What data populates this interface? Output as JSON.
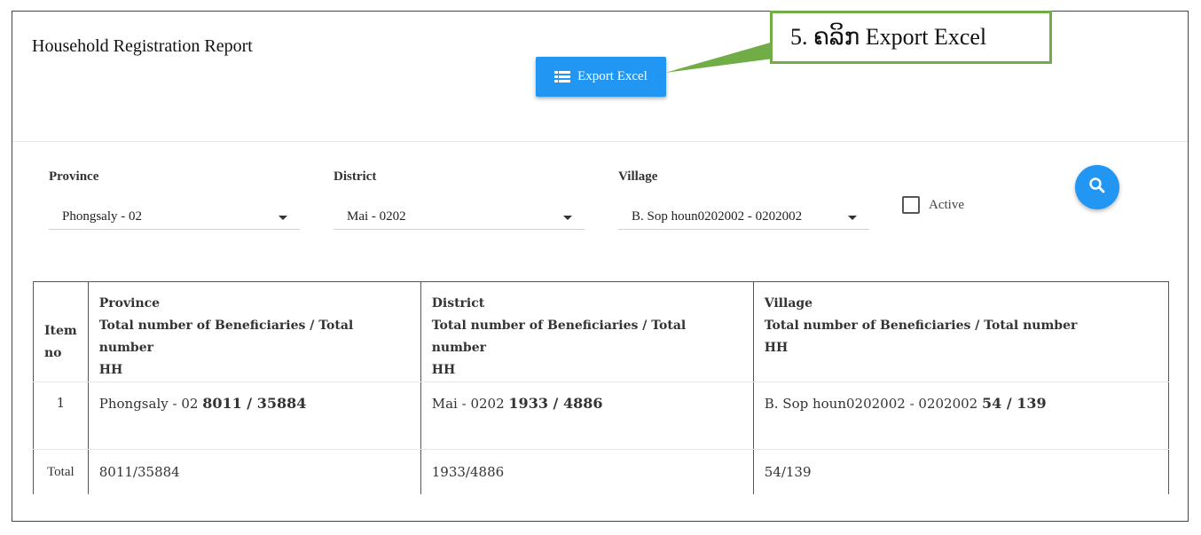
{
  "header": {
    "title": "Household Registration Report",
    "export_label": "Export Excel"
  },
  "filters": {
    "province": {
      "label": "Province",
      "value": "Phongsaly - 02"
    },
    "district": {
      "label": "District",
      "value": "Mai - 0202"
    },
    "village": {
      "label": "Village",
      "value": "B. Sop houn0202002 - 0202002"
    },
    "active_label": "Active"
  },
  "table": {
    "headers": {
      "item": [
        "Item",
        "no"
      ],
      "province": [
        "Province",
        "Total number of Beneficiaries / Total number",
        "HH"
      ],
      "district": [
        "District",
        "Total number of Beneficiaries / Total number",
        "HH"
      ],
      "village": [
        "Village",
        "Total number of Beneficiaries / Total number",
        "HH"
      ]
    },
    "rows": [
      {
        "item": "1",
        "province_name": "Phongsaly - 02",
        "province_count": "8011 / 35884",
        "district_name": "Mai - 0202",
        "district_count": "1933 / 4886",
        "village_name": "B. Sop houn0202002 - 0202002",
        "village_count": "54 / 139"
      }
    ],
    "total": {
      "label": "Total",
      "province": "8011/35884",
      "district": "1933/4886",
      "village": "54/139"
    }
  },
  "annotation": {
    "text": "5. ຄລິກ Export Excel"
  },
  "colors": {
    "primary": "#2196f3",
    "annotation": "#70ad47"
  }
}
